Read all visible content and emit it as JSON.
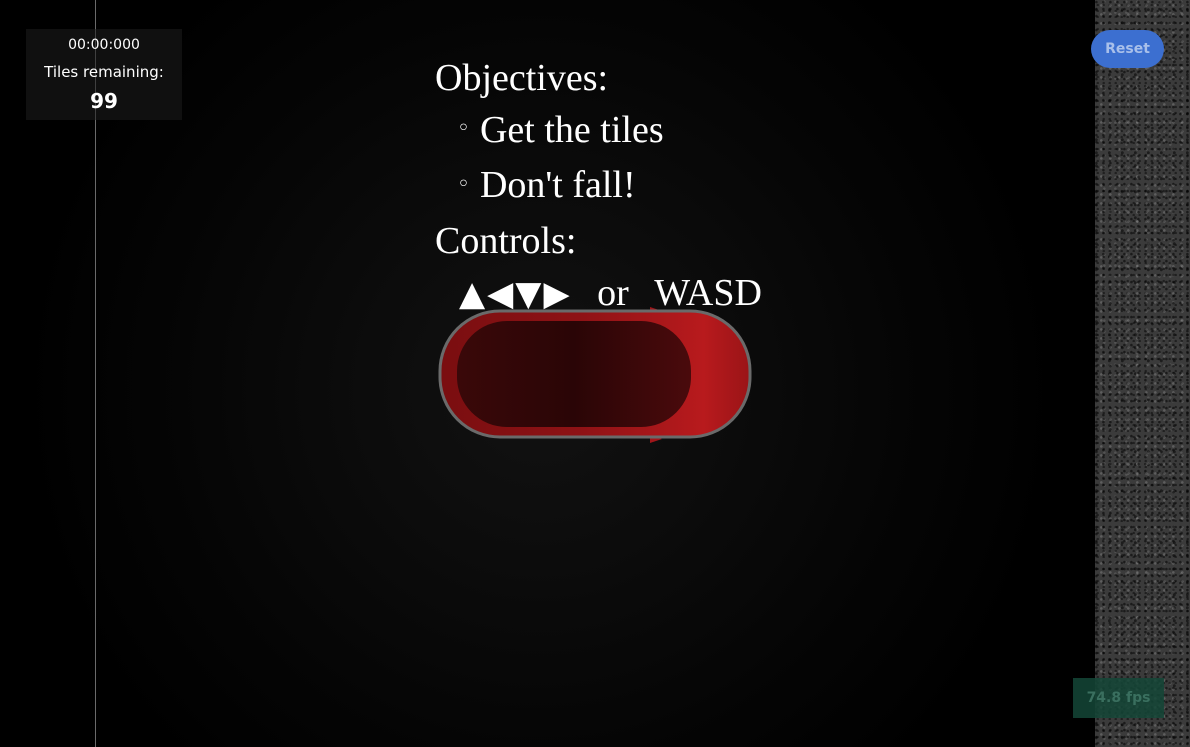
{
  "hud": {
    "timer": "00:00:000",
    "tiles_label": "Tiles remaining:",
    "tiles_count": "99"
  },
  "instructions": {
    "objectives_heading": "Objectives:",
    "objectives": [
      "Get the tiles",
      "Don't fall!"
    ],
    "bullet_symbol": "◦",
    "controls_heading": "Controls:",
    "controls_arrows": "▲◀▼▶",
    "controls_or": "or",
    "controls_keys": "WASD"
  },
  "reset_button": {
    "label": "Reset",
    "color": "#3c6fd0"
  },
  "fps": {
    "value": "74.8 fps"
  },
  "player": {
    "body_color": "#a8161a",
    "icon": "player-car-icon"
  },
  "colors": {
    "background": "#000000",
    "side_panel": "#3b3b3b",
    "text": "#ffffff"
  }
}
